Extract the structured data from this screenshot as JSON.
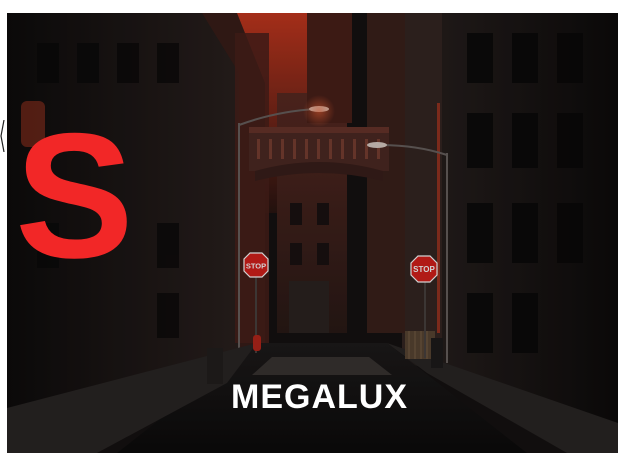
{
  "poster": {
    "initial": "S",
    "brand_name": "MEGALUX",
    "stop_sign_text": "STOP"
  },
  "colors": {
    "accent": "#f22727",
    "brand_text": "#ffffff",
    "night": "#151212",
    "sky": "#8a2a20"
  }
}
